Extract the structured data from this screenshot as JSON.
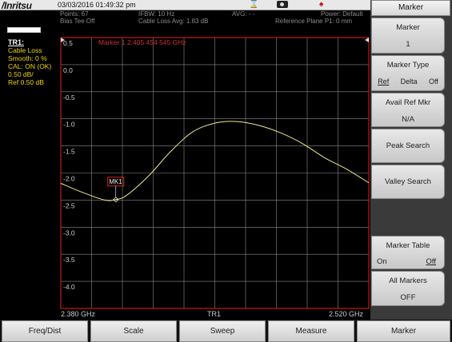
{
  "header": {
    "brand": "/Inritsu",
    "datetime": "03/03/2016 01:49:32 pm",
    "points": "Points: 67",
    "ifbw": "IFBW: 10 Hz",
    "avg": "AVG: - -",
    "power": "Power: Default",
    "bias_tee": "Bias Tee Off",
    "cable_loss_avg": "Cable Loss Avg: 1.83 dB",
    "ref_plane": "Reference Plane P1: 0 mm",
    "marker_readout": "Marker 1 2.405 454 545 GHz"
  },
  "left_panel": {
    "trace_title": "TR1:",
    "lines": [
      "Cable Loss",
      "Smooth: 0 %",
      "CAL: ON (OK)",
      "0.50 dB/",
      "Ref 0.50 dB"
    ]
  },
  "plot": {
    "y_ticks": [
      "0.5",
      "0.0",
      "-0.5",
      "-1.0",
      "-1.5",
      "-2.0",
      "-2.5",
      "-3.0",
      "-3.5",
      "-4.0"
    ],
    "start_freq": "2.380 GHz",
    "trace_label": "TR1",
    "stop_freq": "2.520 GHz",
    "marker_label": "MK1"
  },
  "chart_data": {
    "type": "line",
    "xlabel": "",
    "ylabel": "",
    "xlim": [
      2.38,
      2.52
    ],
    "ylim": [
      -4.5,
      0.5
    ],
    "series": [
      {
        "x": [
          2.38,
          2.39,
          2.4,
          2.405,
          2.41,
          2.42,
          2.43,
          2.44,
          2.45,
          2.46,
          2.47,
          2.48,
          2.49,
          2.5,
          2.51,
          2.52
        ],
        "y": [
          -2.19,
          -2.36,
          -2.5,
          -2.49,
          -2.41,
          -2.05,
          -1.6,
          -1.24,
          -1.08,
          -1.05,
          -1.12,
          -1.26,
          -1.46,
          -1.72,
          -1.93,
          -2.18
        ]
      }
    ],
    "marker": {
      "x": 2.405,
      "y": -2.49,
      "label": "MK1"
    },
    "grid": true
  },
  "softkeys": {
    "header": "Marker",
    "marker": {
      "title": "Marker",
      "value": "1"
    },
    "marker_type": {
      "title": "Marker Type",
      "opt1": "Ref",
      "opt2": "Delta",
      "opt3": "Off"
    },
    "avail_ref": {
      "title": "Avail Ref Mkr",
      "value": "N/A"
    },
    "peak_search": "Peak Search",
    "valley_search": "Valley Search",
    "marker_table": {
      "title": "Marker Table",
      "on": "On",
      "off": "Off"
    },
    "all_markers": {
      "title": "All Markers",
      "value": "OFF"
    }
  },
  "menu": [
    "Freq/Dist",
    "Scale",
    "Sweep",
    "Measure",
    "Marker"
  ],
  "colors": {
    "grid_border": "#c81818",
    "trace": "#f0e88a",
    "text_yellow": "#f0d400",
    "marker_box": "#e02020"
  }
}
